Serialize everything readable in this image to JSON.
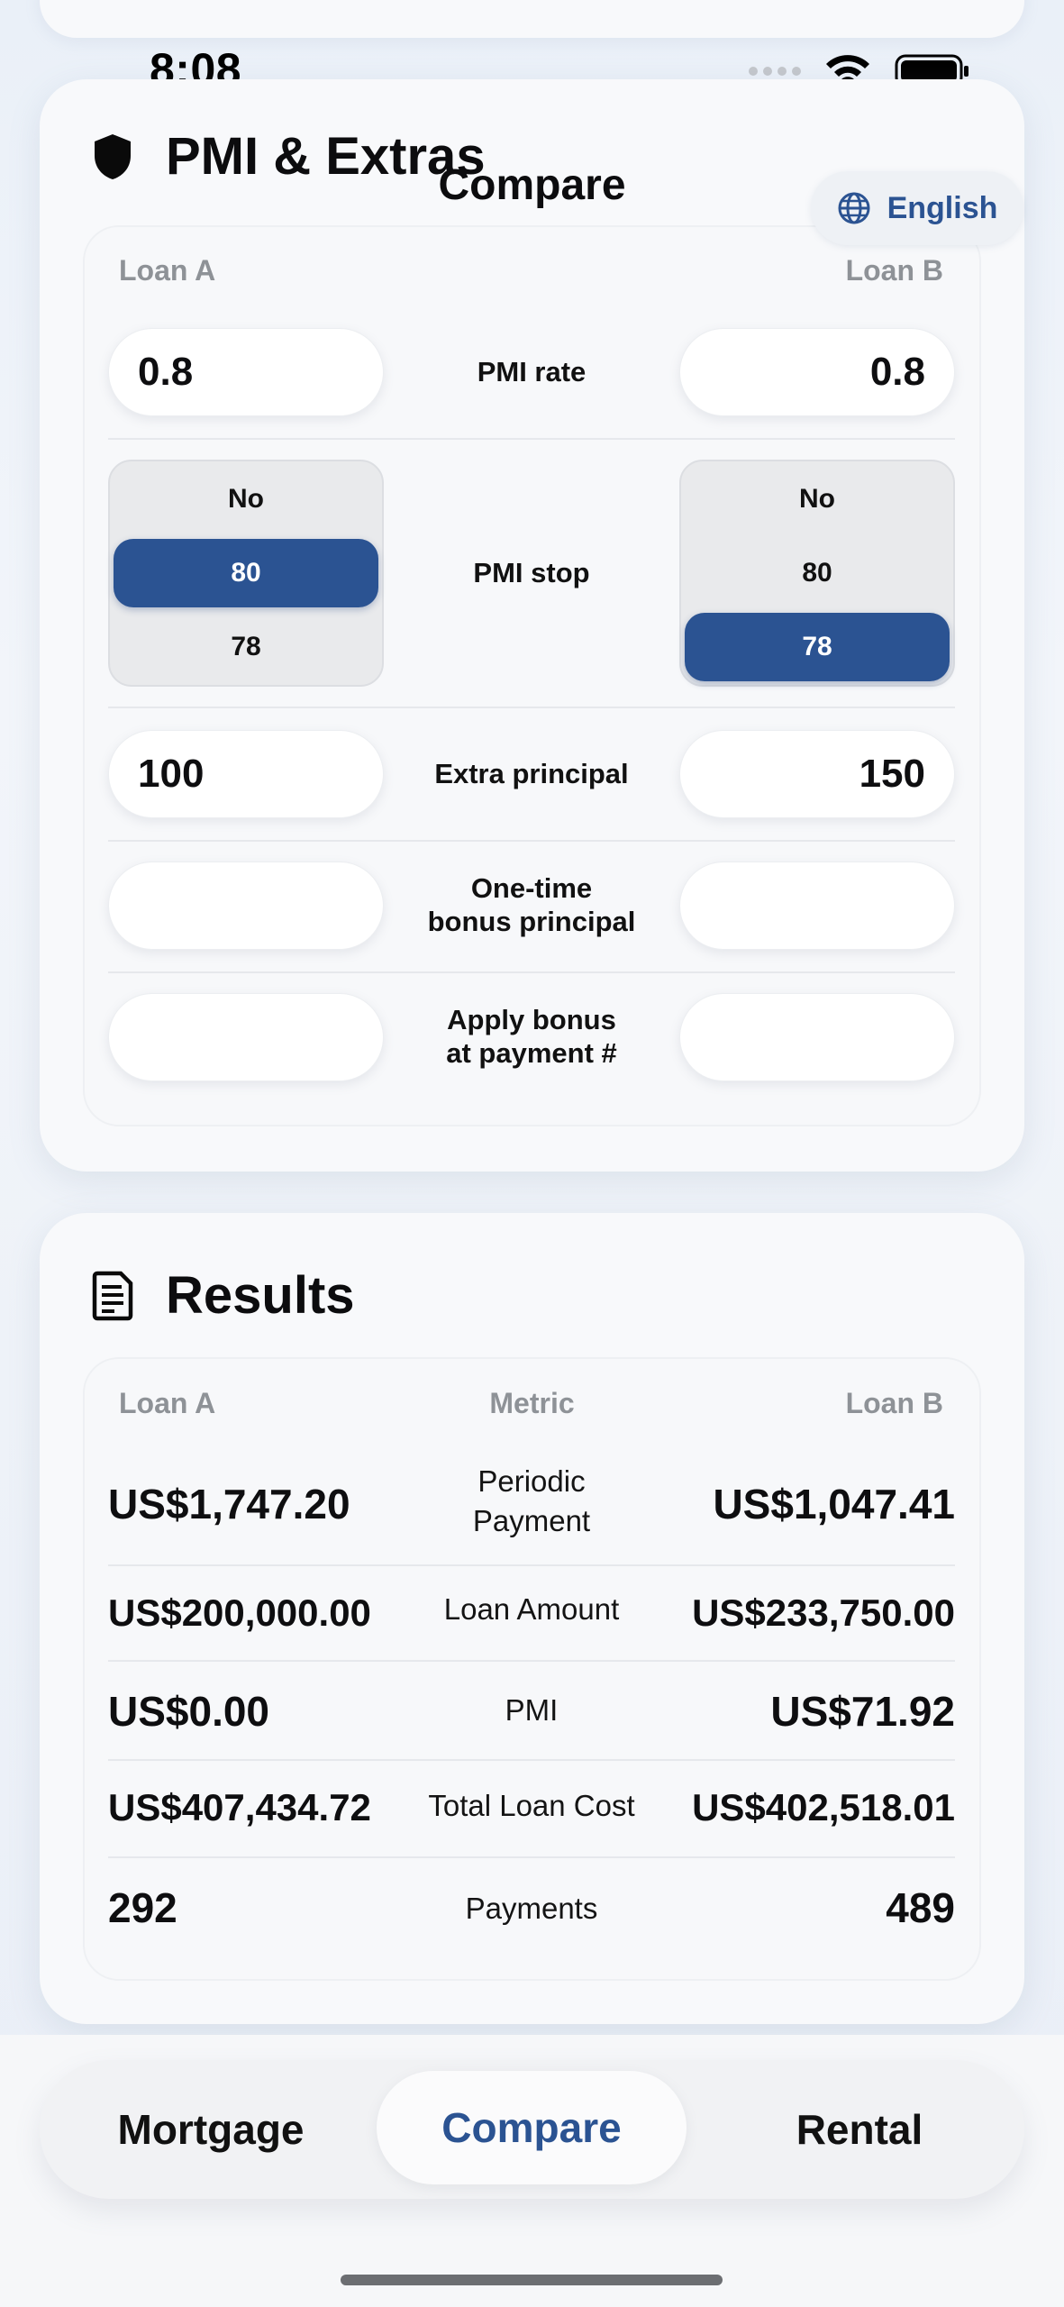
{
  "status_bar": {
    "time": "8:08"
  },
  "header": {
    "title": "Compare",
    "language": "English"
  },
  "pmi_card": {
    "title": "PMI & Extras",
    "loan_a_label": "Loan A",
    "loan_b_label": "Loan B",
    "pmi_rate": {
      "label": "PMI rate",
      "loan_a": "0.8",
      "loan_b": "0.8"
    },
    "pmi_stop": {
      "label": "PMI stop",
      "options": [
        "No",
        "80",
        "78"
      ],
      "loan_a_selected": "80",
      "loan_b_selected": "78"
    },
    "extra_principal": {
      "label": "Extra principal",
      "loan_a": "100",
      "loan_b": "150"
    },
    "bonus_principal": {
      "label_line1": "One-time",
      "label_line2": "bonus principal",
      "loan_a": "",
      "loan_b": ""
    },
    "bonus_payment": {
      "label_line1": "Apply bonus",
      "label_line2": "at payment #",
      "loan_a": "",
      "loan_b": ""
    }
  },
  "results_card": {
    "title": "Results",
    "col_a": "Loan A",
    "col_metric": "Metric",
    "col_b": "Loan B",
    "rows": [
      {
        "metric_line1": "Periodic",
        "metric_line2": "Payment",
        "loan_a": "US$1,747.20",
        "loan_b": "US$1,047.41"
      },
      {
        "metric_line1": "Loan Amount",
        "metric_line2": "",
        "loan_a": "US$200,000.00",
        "loan_b": "US$233,750.00"
      },
      {
        "metric_line1": "PMI",
        "metric_line2": "",
        "loan_a": "US$0.00",
        "loan_b": "US$71.92"
      },
      {
        "metric_line1": "Total Loan Cost",
        "metric_line2": "",
        "loan_a": "US$407,434.72",
        "loan_b": "US$402,518.01"
      },
      {
        "metric_line1": "Payments",
        "metric_line2": "",
        "loan_a": "292",
        "loan_b": "489"
      }
    ]
  },
  "tabs": [
    {
      "label": "Mortgage",
      "active": false
    },
    {
      "label": "Compare",
      "active": true
    },
    {
      "label": "Rental",
      "active": false
    }
  ],
  "colors": {
    "accent": "#2b5392",
    "background": "#eef2f8"
  },
  "icons": {
    "pmi": "shield-icon",
    "results": "document-icon",
    "language": "globe-icon"
  }
}
